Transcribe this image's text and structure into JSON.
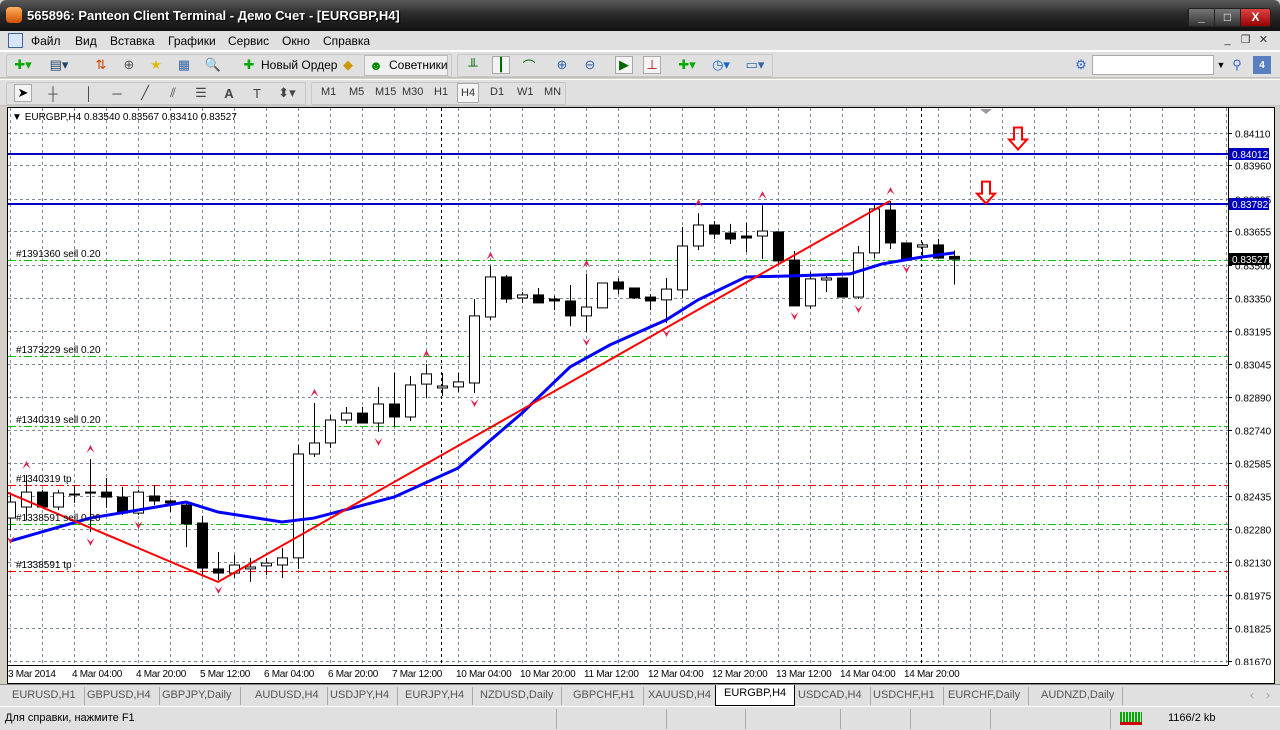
{
  "window": {
    "title": "565896: Panteon Client Terminal - Демо Счет - [EURGBP,H4]",
    "minimize": "_",
    "maximize": "□",
    "close": "X"
  },
  "menu": [
    "Файл",
    "Вид",
    "Вставка",
    "Графики",
    "Сервис",
    "Окно",
    "Справка"
  ],
  "mdi": {
    "minimize": "_",
    "restore": "❐",
    "close": "✕"
  },
  "toolbar": {
    "new_order": "Новый Ордер",
    "experts": "Советники",
    "search_placeholder": ""
  },
  "timeframes": [
    "M1",
    "M5",
    "M15",
    "M30",
    "H1",
    "H4",
    "D1",
    "W1",
    "MN"
  ],
  "active_timeframe": "H4",
  "chart": {
    "symbol_line": "EURGBP,H4  0.83540 0.83567 0.83410 0.83527",
    "colors": {
      "grid": "#7f8c99",
      "ma": "#0000ff",
      "zigzag": "#ff0000",
      "order_line": "#00c000",
      "tp_line": "#ff0000",
      "hline": "#0000c0",
      "fractal": "#e0204a"
    }
  },
  "chart_data": {
    "type": "candlestick",
    "symbol": "EURGBP",
    "timeframe": "H4",
    "ylim": [
      0.816,
      0.8426
    ],
    "y_ticks": [
      "0.84110",
      "0.83960",
      "0.83805",
      "0.83655",
      "0.83500",
      "0.83350",
      "0.83195",
      "0.83045",
      "0.82890",
      "0.82740",
      "0.82585",
      "0.82435",
      "0.82280",
      "0.82130",
      "0.81975",
      "0.81825",
      "0.81670"
    ],
    "x_ticks": [
      "3 Mar 2014",
      "4 Mar 04:00",
      "4 Mar 20:00",
      "5 Mar 12:00",
      "6 Mar 04:00",
      "6 Mar 20:00",
      "7 Mar 12:00",
      "10 Mar 04:00",
      "10 Mar 20:00",
      "11 Mar 12:00",
      "12 Mar 04:00",
      "12 Mar 20:00",
      "13 Mar 12:00",
      "14 Mar 04:00",
      "14 Mar 20:00"
    ],
    "candles_ohlc": [
      [
        0.82331,
        0.82438,
        0.82276,
        0.82405
      ],
      [
        0.82382,
        0.8253,
        0.82322,
        0.82451
      ],
      [
        0.82451,
        0.82461,
        0.82378,
        0.82382
      ],
      [
        0.82382,
        0.82461,
        0.82368,
        0.82447
      ],
      [
        0.82442,
        0.82484,
        0.82401,
        0.82442
      ],
      [
        0.82447,
        0.82604,
        0.82267,
        0.82451
      ],
      [
        0.82451,
        0.82516,
        0.82378,
        0.82428
      ],
      [
        0.82428,
        0.82475,
        0.82345,
        0.82354
      ],
      [
        0.82354,
        0.82461,
        0.82345,
        0.82451
      ],
      [
        0.82433,
        0.82484,
        0.82391,
        0.8241
      ],
      [
        0.8241,
        0.82415,
        0.82359,
        0.82401
      ],
      [
        0.82391,
        0.82405,
        0.82197,
        0.82304
      ],
      [
        0.82308,
        0.82341,
        0.82068,
        0.821
      ],
      [
        0.82096,
        0.82174,
        0.82045,
        0.82077
      ],
      [
        0.82077,
        0.8216,
        0.82054,
        0.82114
      ],
      [
        0.82096,
        0.82147,
        0.82036,
        0.82105
      ],
      [
        0.8211,
        0.82147,
        0.82068,
        0.82123
      ],
      [
        0.82114,
        0.82193,
        0.82054,
        0.82147
      ],
      [
        0.82147,
        0.82669,
        0.82096,
        0.82627
      ],
      [
        0.82627,
        0.82863,
        0.82613,
        0.82678
      ],
      [
        0.82678,
        0.82807,
        0.82655,
        0.82784
      ],
      [
        0.82784,
        0.82844,
        0.82766,
        0.82816
      ],
      [
        0.82816,
        0.82844,
        0.8277,
        0.8277
      ],
      [
        0.8277,
        0.82937,
        0.82729,
        0.82858
      ],
      [
        0.82858,
        0.83001,
        0.82752,
        0.82798
      ],
      [
        0.82798,
        0.82987,
        0.82779,
        0.82946
      ],
      [
        0.8295,
        0.83043,
        0.82886,
        0.82997
      ],
      [
        0.82932,
        0.83001,
        0.82895,
        0.82941
      ],
      [
        0.82937,
        0.83001,
        0.82913,
        0.8296
      ],
      [
        0.82955,
        0.83343,
        0.82909,
        0.83265
      ],
      [
        0.8326,
        0.83496,
        0.83246,
        0.83445
      ],
      [
        0.83445,
        0.83454,
        0.83325,
        0.83343
      ],
      [
        0.83348,
        0.83375,
        0.83325,
        0.83362
      ],
      [
        0.83362,
        0.83394,
        0.83325,
        0.83325
      ],
      [
        0.83343,
        0.83357,
        0.83292,
        0.83334
      ],
      [
        0.83334,
        0.83408,
        0.83218,
        0.83265
      ],
      [
        0.83265,
        0.83459,
        0.83191,
        0.83306
      ],
      [
        0.83302,
        0.83417,
        0.83302,
        0.83417
      ],
      [
        0.83422,
        0.8344,
        0.83366,
        0.83389
      ],
      [
        0.83394,
        0.83394,
        0.83343,
        0.83348
      ],
      [
        0.83352,
        0.83366,
        0.83292,
        0.83334
      ],
      [
        0.83339,
        0.8344,
        0.83232,
        0.83389
      ],
      [
        0.83385,
        0.83676,
        0.83348,
        0.83588
      ],
      [
        0.83588,
        0.8374,
        0.83569,
        0.83685
      ],
      [
        0.83685,
        0.83703,
        0.8362,
        0.83643
      ],
      [
        0.83648,
        0.8369,
        0.83597,
        0.8362
      ],
      [
        0.83634,
        0.83694,
        0.8356,
        0.83625
      ],
      [
        0.83634,
        0.83777,
        0.83528,
        0.83657
      ],
      [
        0.83653,
        0.83653,
        0.835,
        0.83519
      ],
      [
        0.83523,
        0.83565,
        0.83311,
        0.83311
      ],
      [
        0.83311,
        0.83468,
        0.83297,
        0.83436
      ],
      [
        0.83431,
        0.83454,
        0.83375,
        0.8344
      ],
      [
        0.8344,
        0.8344,
        0.83352,
        0.83352
      ],
      [
        0.83352,
        0.83588,
        0.83343,
        0.83556
      ],
      [
        0.83556,
        0.83777,
        0.83532,
        0.83759
      ],
      [
        0.83754,
        0.83796,
        0.83574,
        0.83602
      ],
      [
        0.83602,
        0.83602,
        0.83528,
        0.83528
      ],
      [
        0.83583,
        0.83606,
        0.83537,
        0.83593
      ],
      [
        0.83593,
        0.8362,
        0.83532,
        0.83532
      ],
      [
        0.8354,
        0.83567,
        0.8341,
        0.83527
      ]
    ],
    "moving_average": [
      [
        1,
        0.82225
      ],
      [
        6,
        0.82331
      ],
      [
        12,
        0.82405
      ],
      [
        14,
        0.82359
      ],
      [
        18,
        0.82313
      ],
      [
        20,
        0.82331
      ],
      [
        25,
        0.82428
      ],
      [
        29,
        0.82562
      ],
      [
        33,
        0.82816
      ],
      [
        36,
        0.83029
      ],
      [
        38.5,
        0.83131
      ],
      [
        42,
        0.83246
      ],
      [
        44,
        0.83339
      ],
      [
        47,
        0.83445
      ],
      [
        50,
        0.8345
      ],
      [
        53.5,
        0.83459
      ],
      [
        55.5,
        0.83505
      ],
      [
        58,
        0.83537
      ],
      [
        60,
        0.83556
      ]
    ],
    "zigzag": [
      [
        0,
        0.82475
      ],
      [
        14,
        0.82036
      ],
      [
        56,
        0.83796
      ]
    ],
    "fractals_up": [
      2,
      6,
      20,
      27,
      31,
      37,
      44,
      48,
      56
    ],
    "fractals_down": [
      1,
      6,
      9,
      14,
      24,
      30,
      37,
      42,
      50,
      54,
      57
    ],
    "signal_arrows_down": [
      [
        64,
        0.8408
      ],
      [
        62,
        0.8383
      ]
    ],
    "horizontal_lines": [
      {
        "price": "0.84012"
      },
      {
        "price": "0.83782"
      }
    ],
    "bid": "0.83527",
    "orders": [
      {
        "label": "#1391360 sell 0.20",
        "price": 0.83523,
        "kind": "sell"
      },
      {
        "label": "#1373229 sell 0.20",
        "price": 0.8308,
        "kind": "sell"
      },
      {
        "label": "#1340319 sell 0.20",
        "price": 0.82756,
        "kind": "sell"
      },
      {
        "label": "#1340319 tp",
        "price": 0.82484,
        "kind": "tp"
      },
      {
        "label": "#1338591 sell 0.20",
        "price": 0.82304,
        "kind": "sell"
      },
      {
        "label": "#1338591 tp",
        "price": 0.82086,
        "kind": "tp"
      }
    ],
    "period_separators": [
      "10 Mar 00:00",
      "14 Mar 16:00"
    ]
  },
  "tabs": [
    "EURUSD,H1",
    "GBPUSD,H4",
    "GBPJPY,Daily",
    "AUDUSD,H4",
    "USDJPY,H4",
    "EURJPY,H4",
    "NZDUSD,Daily",
    "GBPCHF,H1",
    "XAUUSD,H4",
    "EURGBP,H4",
    "USDCAD,H4",
    "USDCHF,H1",
    "EURCHF,Daily",
    "AUDNZD,Daily"
  ],
  "active_tab": "EURGBP,H4",
  "tab_scroll": {
    "left": "‹",
    "right": "›"
  },
  "status": {
    "help": "Для справки, нажмите F1",
    "traffic": "1166/2 kb"
  }
}
